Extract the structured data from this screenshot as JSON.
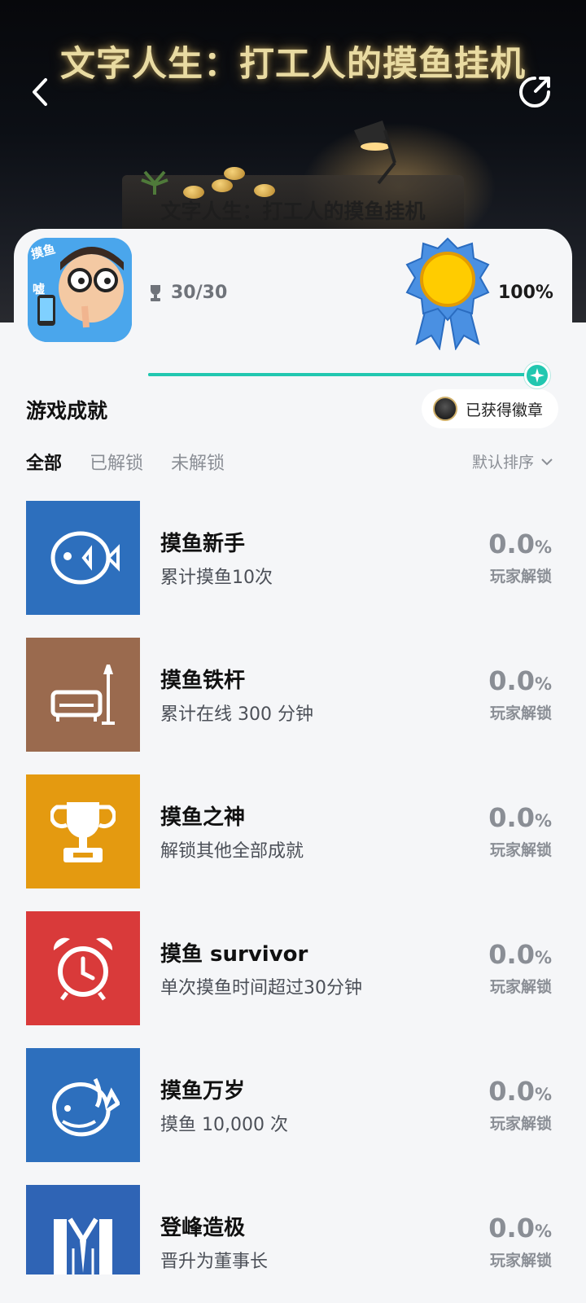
{
  "header": {
    "banner_title": "文字人生：打工人的摸鱼挂机",
    "banner_subtitle": "文字人生：打工人的摸鱼挂机"
  },
  "game": {
    "trophy_count": "30/30",
    "completion": "100%",
    "progress": 1.0,
    "icon_text_top": "摸鱼",
    "icon_text_side": "嘘"
  },
  "section": {
    "title": "游戏成就",
    "badge_label": "已获得徽章"
  },
  "tabs": [
    {
      "label": "全部",
      "active": true
    },
    {
      "label": "已解锁",
      "active": false
    },
    {
      "label": "未解锁",
      "active": false
    }
  ],
  "sort": {
    "label": "默认排序"
  },
  "achievements": [
    {
      "name": "摸鱼新手",
      "desc": "累计摸鱼10次",
      "rate": "0.0",
      "pct": "%",
      "rate_label": "玩家解锁",
      "icon": "fish-icon",
      "color": "#2d6fbd"
    },
    {
      "name": "摸鱼铁杆",
      "desc": "累计在线 300 分钟",
      "rate": "0.0",
      "pct": "%",
      "rate_label": "玩家解锁",
      "icon": "sofa-lamp-icon",
      "color": "#9a6a4e"
    },
    {
      "name": "摸鱼之神",
      "desc": "解锁其他全部成就",
      "rate": "0.0",
      "pct": "%",
      "rate_label": "玩家解锁",
      "icon": "trophy-icon",
      "color": "#e49a10"
    },
    {
      "name": "摸鱼 survivor",
      "desc": "单次摸鱼时间超过30分钟",
      "rate": "0.0",
      "pct": "%",
      "rate_label": "玩家解锁",
      "icon": "alarm-clock-icon",
      "color": "#d93a3a"
    },
    {
      "name": "摸鱼万岁",
      "desc": "摸鱼 10,000 次",
      "rate": "0.0",
      "pct": "%",
      "rate_label": "玩家解锁",
      "icon": "whale-icon",
      "color": "#2d6fbd"
    },
    {
      "name": "登峰造极",
      "desc": "晋升为董事长",
      "rate": "0.0",
      "pct": "%",
      "rate_label": "玩家解锁",
      "icon": "suit-icon",
      "color": "#2f64b5"
    }
  ]
}
